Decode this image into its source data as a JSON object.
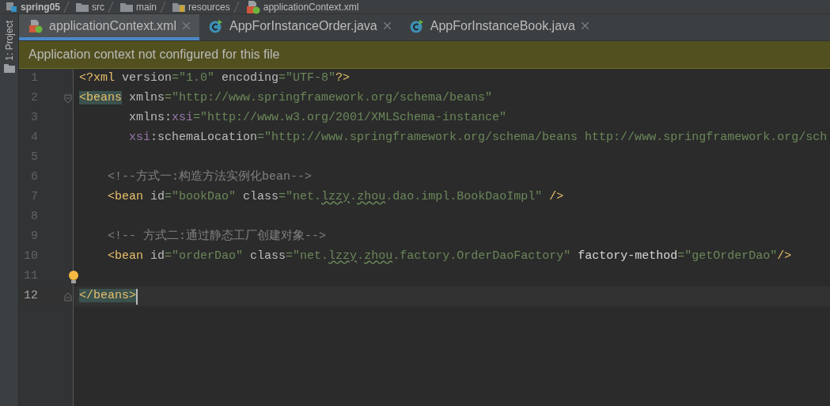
{
  "breadcrumb": [
    {
      "label": "spring05",
      "kind": "module"
    },
    {
      "label": "src",
      "kind": "folder"
    },
    {
      "label": "main",
      "kind": "folder"
    },
    {
      "label": "resources",
      "kind": "resources"
    },
    {
      "label": "applicationContext.xml",
      "kind": "xml"
    }
  ],
  "tool_strip": {
    "label": "1: Project"
  },
  "tabs": [
    {
      "label": "applicationContext.xml",
      "kind": "xml",
      "selected": true
    },
    {
      "label": "AppForInstanceOrder.java",
      "kind": "java",
      "selected": false
    },
    {
      "label": "AppForInstanceBook.java",
      "kind": "java",
      "selected": false
    }
  ],
  "banner": {
    "text": "Application context not configured for this file"
  },
  "editor": {
    "lines": [
      {
        "number": "1",
        "kind": "root",
        "current": false,
        "tokens": [
          {
            "kind": "tag",
            "text": "<?xml "
          },
          {
            "kind": "attr",
            "text": "version"
          },
          {
            "kind": "value",
            "text": "=\"1.0\" "
          },
          {
            "kind": "attr",
            "text": "encoding"
          },
          {
            "kind": "value",
            "text": "=\"UTF-8\""
          },
          {
            "kind": "tag",
            "text": "?>"
          }
        ]
      },
      {
        "number": "2",
        "kind": "root",
        "current": false,
        "opens_fold": true,
        "tokens": [
          {
            "kind": "tag_match",
            "text": "<beans"
          },
          {
            "kind": "attr",
            "text": " xmlns"
          },
          {
            "kind": "value",
            "text": "=\"http://www.springframework.org/schema/beans\""
          }
        ]
      },
      {
        "number": "3",
        "kind": "continuation",
        "current": false,
        "tokens": [
          {
            "kind": "attr",
            "text": "xmlns:"
          },
          {
            "kind": "namespace",
            "text": "xsi"
          },
          {
            "kind": "value",
            "text": "=\"http://www.w3.org/2001/XMLSchema-instance\""
          }
        ]
      },
      {
        "number": "4",
        "kind": "continuation",
        "current": false,
        "tokens": [
          {
            "kind": "namespace",
            "text": "xsi"
          },
          {
            "kind": "attr",
            "text": ":schemaLocation"
          },
          {
            "kind": "value",
            "text": "=\"http://www.springframework.org/schema/beans http://www.springframework.org/sch"
          }
        ]
      },
      {
        "number": "5",
        "kind": "blank",
        "current": false
      },
      {
        "number": "6",
        "kind": "child",
        "current": false,
        "tokens": [
          {
            "kind": "comment",
            "text": "<!--方式一:构造方法实例化bean-->"
          }
        ]
      },
      {
        "number": "7",
        "kind": "child",
        "current": false,
        "tokens": [
          {
            "kind": "tag",
            "text": "<bean "
          },
          {
            "kind": "attr",
            "text": "id"
          },
          {
            "kind": "value",
            "text": "=\"bookDao\" "
          },
          {
            "kind": "attr",
            "text": "class"
          },
          {
            "kind": "value",
            "text": "=\"net."
          },
          {
            "kind": "typo",
            "text": "lzzy"
          },
          {
            "kind": "value",
            "text": "."
          },
          {
            "kind": "typo",
            "text": "zhou"
          },
          {
            "kind": "value",
            "text": ".dao.impl.BookDaoImpl\" "
          },
          {
            "kind": "tag",
            "text": "/>"
          }
        ]
      },
      {
        "number": "8",
        "kind": "blank",
        "current": false
      },
      {
        "number": "9",
        "kind": "child",
        "current": false,
        "tokens": [
          {
            "kind": "comment",
            "text": "<!-- 方式二:通过静态工厂创建对象-->"
          }
        ]
      },
      {
        "number": "10",
        "kind": "child",
        "current": false,
        "tokens": [
          {
            "kind": "tag",
            "text": "<bean "
          },
          {
            "kind": "attr",
            "text": "id"
          },
          {
            "kind": "value",
            "text": "=\"orderDao\" "
          },
          {
            "kind": "attr",
            "text": "class"
          },
          {
            "kind": "value",
            "text": "=\"net."
          },
          {
            "kind": "typo",
            "text": "lzzy"
          },
          {
            "kind": "value",
            "text": "."
          },
          {
            "kind": "typo",
            "text": "zhou"
          },
          {
            "kind": "value",
            "text": ".factory.OrderDaoFactory\" "
          },
          {
            "kind": "unknown_attr",
            "text": "factory-method"
          },
          {
            "kind": "value",
            "text": "=\"getOrderDao\""
          },
          {
            "kind": "tag",
            "text": "/>"
          }
        ]
      },
      {
        "number": "11",
        "kind": "blank",
        "current": false,
        "bulb": true
      },
      {
        "number": "12",
        "kind": "root",
        "current": true,
        "closes_fold": true,
        "tokens": [
          {
            "kind": "tag_match",
            "text": "</beans>"
          }
        ]
      }
    ]
  }
}
